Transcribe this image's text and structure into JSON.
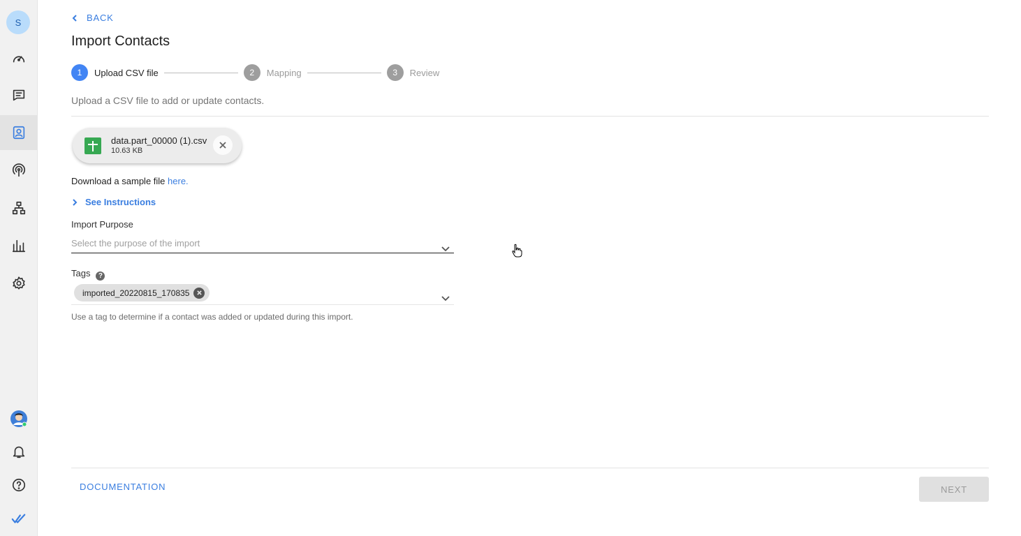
{
  "sidebar": {
    "workspace_initial": "S",
    "items": [
      {
        "icon": "dashboard-gauge-icon"
      },
      {
        "icon": "conversations-icon"
      },
      {
        "icon": "contacts-icon",
        "active": true
      },
      {
        "icon": "broadcast-icon"
      },
      {
        "icon": "workflows-icon"
      },
      {
        "icon": "reports-icon"
      },
      {
        "icon": "settings-icon"
      }
    ],
    "bottom": [
      "user-avatar-icon",
      "notifications-bell-icon",
      "help-icon",
      "brand-logo-icon"
    ],
    "accent_color": "#3a7ee0"
  },
  "header": {
    "back_label": "BACK",
    "title": "Import Contacts"
  },
  "stepper": {
    "steps": [
      {
        "number": "1",
        "label": "Upload CSV file",
        "active": true
      },
      {
        "number": "2",
        "label": "Mapping",
        "active": false
      },
      {
        "number": "3",
        "label": "Review",
        "active": false
      }
    ]
  },
  "upload": {
    "subtitle": "Upload a CSV file to add or update contacts.",
    "file_name": "data.part_00000 (1).csv",
    "file_size": "10.63 KB",
    "sample_text": "Download a sample file ",
    "sample_link": "here.",
    "instructions_label": "See Instructions"
  },
  "import_purpose": {
    "label": "Import Purpose",
    "placeholder": "Select the purpose of the import"
  },
  "tags": {
    "label": "Tags",
    "help_glyph": "?",
    "chips": [
      "imported_20220815_170835"
    ],
    "hint": "Use a tag to determine if a contact was added or updated during this import."
  },
  "footer": {
    "documentation_label": "DOCUMENTATION",
    "next_label": "NEXT",
    "next_disabled": true
  }
}
